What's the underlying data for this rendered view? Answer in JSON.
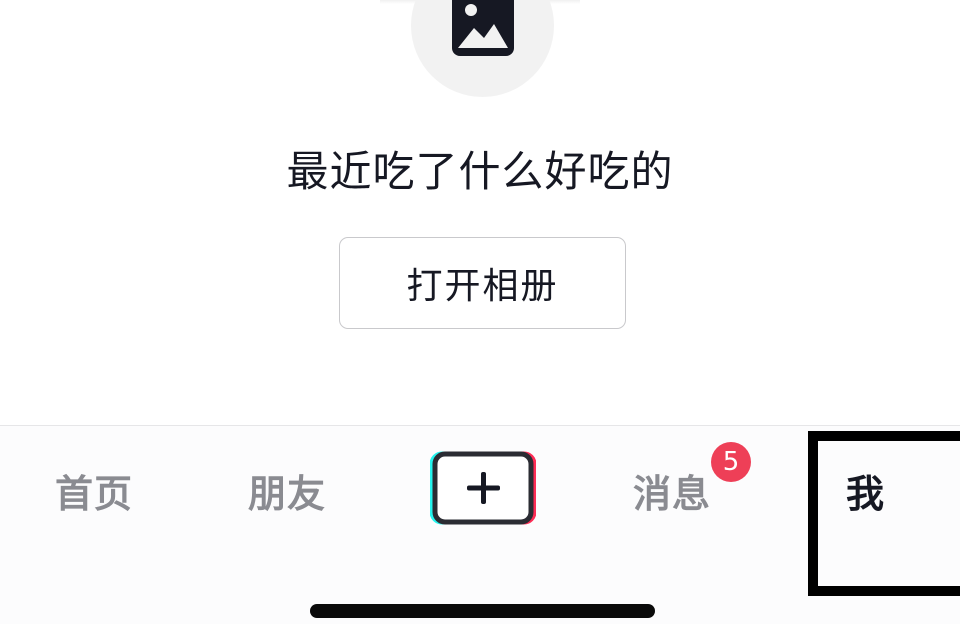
{
  "content": {
    "empty_title": "最近吃了什么好吃的",
    "open_album_label": "打开相册",
    "photo_icon": "image-icon"
  },
  "tab_bar": {
    "items": [
      {
        "label": "首页"
      },
      {
        "label": "朋友"
      },
      {
        "label": "+",
        "icon": "plus-icon"
      },
      {
        "label": "消息",
        "badge": "5"
      },
      {
        "label": "我"
      }
    ],
    "active_tab": "我"
  },
  "colors": {
    "badge": "#ee3f57",
    "active_tab_text": "#161823",
    "inactive_tab_text": "#8a8b91",
    "create_accent_left": "#25f4ee",
    "create_accent_right": "#fe2c55"
  }
}
